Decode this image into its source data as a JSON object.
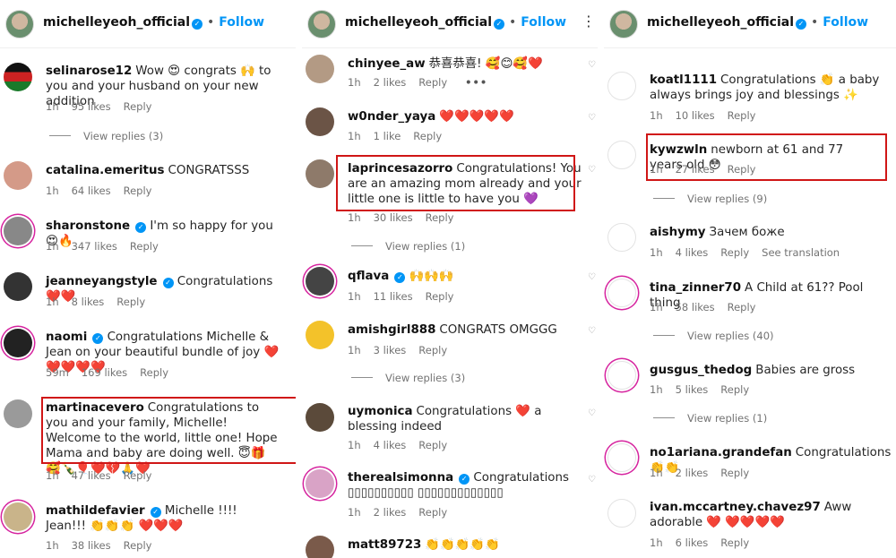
{
  "panels": [
    {
      "header": {
        "username": "michelleyeoh_official",
        "follow": "Follow"
      },
      "comments": [
        {
          "user": "selinarose12",
          "text": "Wow 😍 congrats 🙌 to you and your husband on your new addition",
          "time": "1h",
          "likes": "95 likes",
          "reply": "Reply",
          "view_replies": "View replies (3)"
        },
        {
          "user": "catalina.emeritus",
          "text": "CONGRATSSS",
          "time": "1h",
          "likes": "64 likes",
          "reply": "Reply"
        },
        {
          "user": "sharonstone",
          "verified": true,
          "text": "I'm so happy for you 😍🔥",
          "time": "1h",
          "likes": "347 likes",
          "reply": "Reply"
        },
        {
          "user": "jeanneyangstyle",
          "verified": true,
          "text": "Congratulations ❤️❤️",
          "time": "1h",
          "likes": "8 likes",
          "reply": "Reply"
        },
        {
          "user": "naomi",
          "verified": true,
          "text": "Congratulations Michelle & Jean on your beautiful bundle of joy ❤️❤️❤️❤️❤️",
          "time": "59m",
          "likes": "169 likes",
          "reply": "Reply"
        },
        {
          "user": "martinacevero",
          "text": "Congratulations to you and your family, Michelle! Welcome to the world, little one! Hope Mama and baby are doing well. 😇🎁🥰🍾🎈❤️💔🙏❤️",
          "time": "1h",
          "likes": "47 likes",
          "reply": "Reply"
        },
        {
          "user": "mathildefavier",
          "verified": true,
          "text": "Michelle !!!! Jean!!! 👏👏👏 ❤️❤️❤️",
          "time": "1h",
          "likes": "38 likes",
          "reply": "Reply"
        }
      ]
    },
    {
      "header": {
        "username": "michelleyeoh_official",
        "follow": "Follow"
      },
      "comments": [
        {
          "user": "chinyee_aw",
          "text": "恭喜恭喜! 🥰😊🥰❤️",
          "time": "1h",
          "likes": "2 likes",
          "reply": "Reply",
          "more": "•••"
        },
        {
          "user": "w0nder_yaya",
          "text": "❤️❤️❤️❤️❤️",
          "time": "1h",
          "likes": "1 like",
          "reply": "Reply"
        },
        {
          "user": "laprincesazorro",
          "text": "Congratulations! You are an amazing mom already and your little one is little to have you 💜",
          "time": "1h",
          "likes": "30 likes",
          "reply": "Reply",
          "view_replies": "View replies (1)"
        },
        {
          "user": "qflava",
          "verified": true,
          "text": "🙌🙌🙌",
          "time": "1h",
          "likes": "11 likes",
          "reply": "Reply"
        },
        {
          "user": "amishgirl888",
          "text": "CONGRATS OMGGG",
          "time": "1h",
          "likes": "3 likes",
          "reply": "Reply",
          "view_replies": "View replies (3)"
        },
        {
          "user": "uymonica",
          "text": "Congratulations ❤️ a blessing indeed",
          "time": "1h",
          "likes": "4 likes",
          "reply": "Reply"
        },
        {
          "user": "therealsimonna",
          "verified": true,
          "text": "Congratulations ▯▯▯▯▯▯▯▯▯▯ ▯▯▯▯▯▯▯▯▯▯▯▯▯",
          "time": "1h",
          "likes": "2 likes",
          "reply": "Reply"
        },
        {
          "user": "matt89723",
          "text": "👏👏👏👏👏"
        }
      ]
    },
    {
      "header": {
        "username": "michelleyeoh_official",
        "follow": "Follow"
      },
      "comments": [
        {
          "user": "koatl1111",
          "text": "Congratulations 👏 a baby always brings joy and blessings ✨",
          "time": "1h",
          "likes": "10 likes",
          "reply": "Reply"
        },
        {
          "user": "kywzwln",
          "text": "newborn at 61 and 77 years old 😳",
          "time": "1h",
          "likes": "27 likes",
          "reply": "Reply",
          "view_replies": "View replies (9)"
        },
        {
          "user": "aishymy",
          "text": "Зачем боже",
          "time": "1h",
          "likes": "4 likes",
          "reply": "Reply",
          "extra": "See translation"
        },
        {
          "user": "tina_zinner70",
          "text": "A Child at 61?? Pool thing",
          "time": "1h",
          "likes": "58 likes",
          "reply": "Reply",
          "view_replies": "View replies (40)"
        },
        {
          "user": "gusgus_thedog",
          "text": "Babies are gross",
          "time": "1h",
          "likes": "5 likes",
          "reply": "Reply",
          "view_replies": "View replies (1)"
        },
        {
          "user": "no1ariana.grandefan",
          "text": "Congratulations 👏👏",
          "time": "1h",
          "likes": "2 likes",
          "reply": "Reply"
        },
        {
          "user": "ivan.mccartney.chavez97",
          "text": "Aww adorable ❤️ ❤️❤️❤️❤️",
          "time": "1h",
          "likes": "6 likes",
          "reply": "Reply"
        }
      ]
    }
  ],
  "colors": {
    "accent": "#0095f6",
    "highlight": "#d01616",
    "meta": "#737373"
  },
  "icons": [
    "verified-badge-icon",
    "heart-like-icon",
    "more-options-icon"
  ]
}
